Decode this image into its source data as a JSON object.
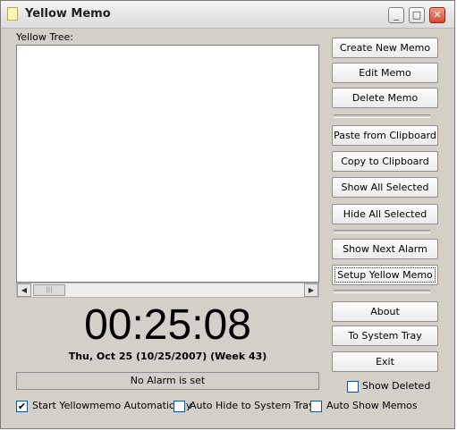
{
  "window": {
    "title": "Yellow Memo",
    "minimize": "_",
    "maximize": "□",
    "close": "✕"
  },
  "tree": {
    "label": "Yellow Tree:"
  },
  "scroll": {
    "left": "◀",
    "right": "▶",
    "thumb": "|||"
  },
  "clock": {
    "time": "00:25:08",
    "date": "Thu, Oct 25 (10/25/2007) (Week 43)"
  },
  "alarm_status": "No Alarm is set",
  "buttons": {
    "create": "Create New Memo",
    "edit": "Edit Memo",
    "delete": "Delete Memo",
    "paste": "Paste from Clipboard",
    "copy": "Copy to Clipboard",
    "show_all": "Show All Selected",
    "hide_all": "Hide All Selected",
    "next_alarm": "Show Next Alarm",
    "setup": "Setup Yellow Memo",
    "about": "About",
    "tray": "To System Tray",
    "exit": "Exit"
  },
  "checkboxes": {
    "show_deleted": {
      "label": "Show Deleted",
      "checked": false
    },
    "start_auto": {
      "label": "Start Yellowmemo Automatically",
      "checked": true
    },
    "auto_hide": {
      "label": "Auto Hide to System Tray",
      "checked": false
    },
    "auto_show": {
      "label": "Auto Show Memos",
      "checked": false
    }
  },
  "check_glyph": "✔"
}
